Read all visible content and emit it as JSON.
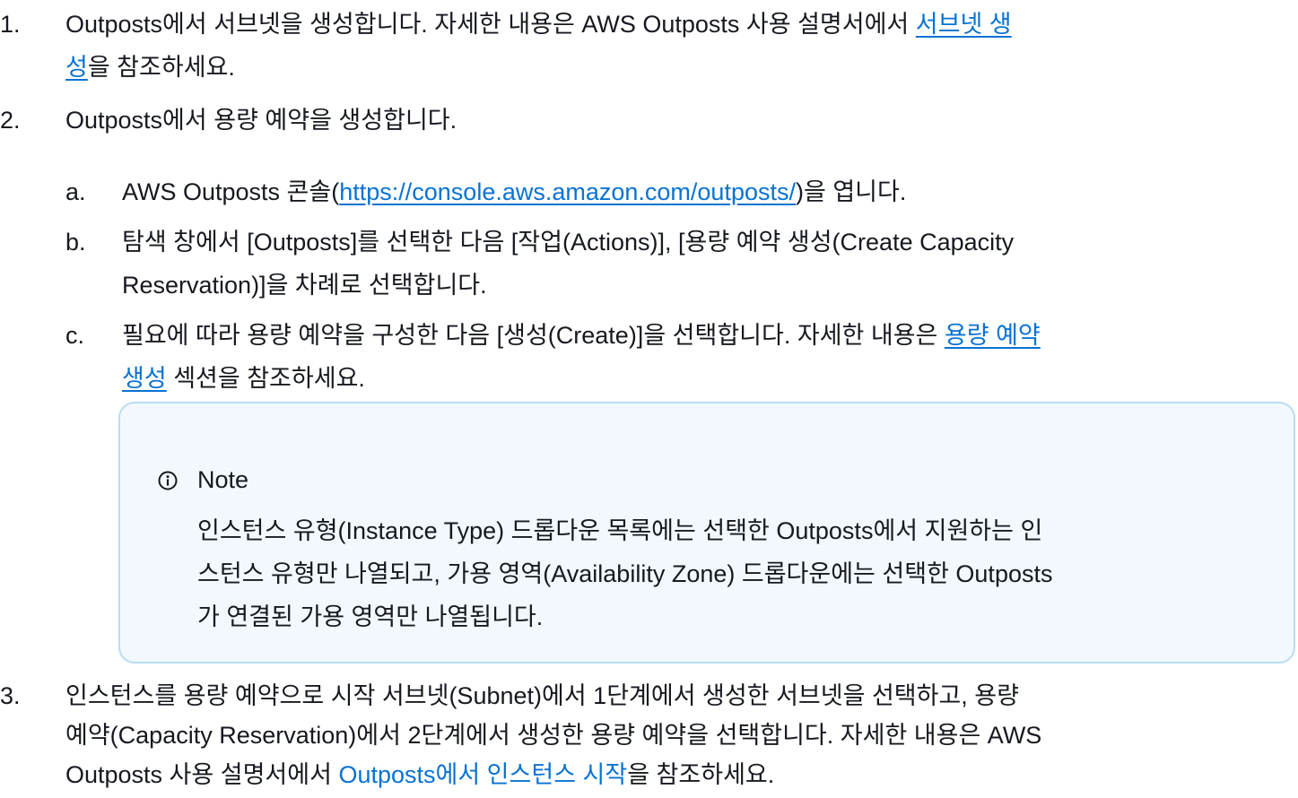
{
  "steps": [
    {
      "num": "1.",
      "line1_pre": "Outposts에서 서브넷을 생성합니다. 자세한 내용은 AWS Outposts 사용 설명서에서 ",
      "link": "서브넷 생성",
      "link_line1": "서브넷 생",
      "link_line2": "성",
      "line2_post": "을 참조하세요."
    },
    {
      "num": "2.",
      "text": "Outposts에서 용량 예약을 생성합니다.",
      "substeps": [
        {
          "num": "a.",
          "pre": "AWS Outposts 콘솔(",
          "link": "https://console.aws.amazon.com/outposts/",
          "post": ")을 엽니다."
        },
        {
          "num": "b.",
          "line1": "탐색 창에서 [Outposts]를 선택한 다음 [작업(Actions)], [용량 예약 생성(Create Capacity",
          "line2": "Reservation)]을 차례로 선택합니다."
        },
        {
          "num": "c.",
          "line1_pre": "필요에 따라 용량 예약을 구성한 다음 [생성(Create)]을 선택합니다. 자세한 내용은 ",
          "link_line1": "용량 예약",
          "link_line2": "생성",
          "line2_post": " 섹션을 참조하세요."
        }
      ]
    },
    {
      "num": "3.",
      "line1": "인스턴스를 용량 예약으로 시작 서브넷(Subnet)에서 1단계에서 생성한 서브넷을 선택하고, 용량",
      "line2": "예약(Capacity Reservation)에서 2단계에서 생성한 용량 예약을 선택합니다. 자세한 내용은 AWS",
      "line3_pre": "Outposts 사용 설명서에서 ",
      "link": "Outposts에서 인스턴스 시작",
      "line3_post": "을 참조하세요."
    }
  ],
  "note": {
    "icon": "info-icon",
    "title": "Note",
    "lines": [
      "인스턴스 유형(Instance Type) 드롭다운 목록에는 선택한 Outposts에서 지원하는 인",
      "스턴스 유형만 나열되고, 가용 영역(Availability Zone) 드롭다운에는 선택한 Outposts",
      "가 연결된 가용 영역만 나열됩니다."
    ]
  },
  "colors": {
    "text": "#16191f",
    "link": "#0972d3",
    "note_bg": "#f2f8fd",
    "note_border": "#b9dcf5"
  }
}
